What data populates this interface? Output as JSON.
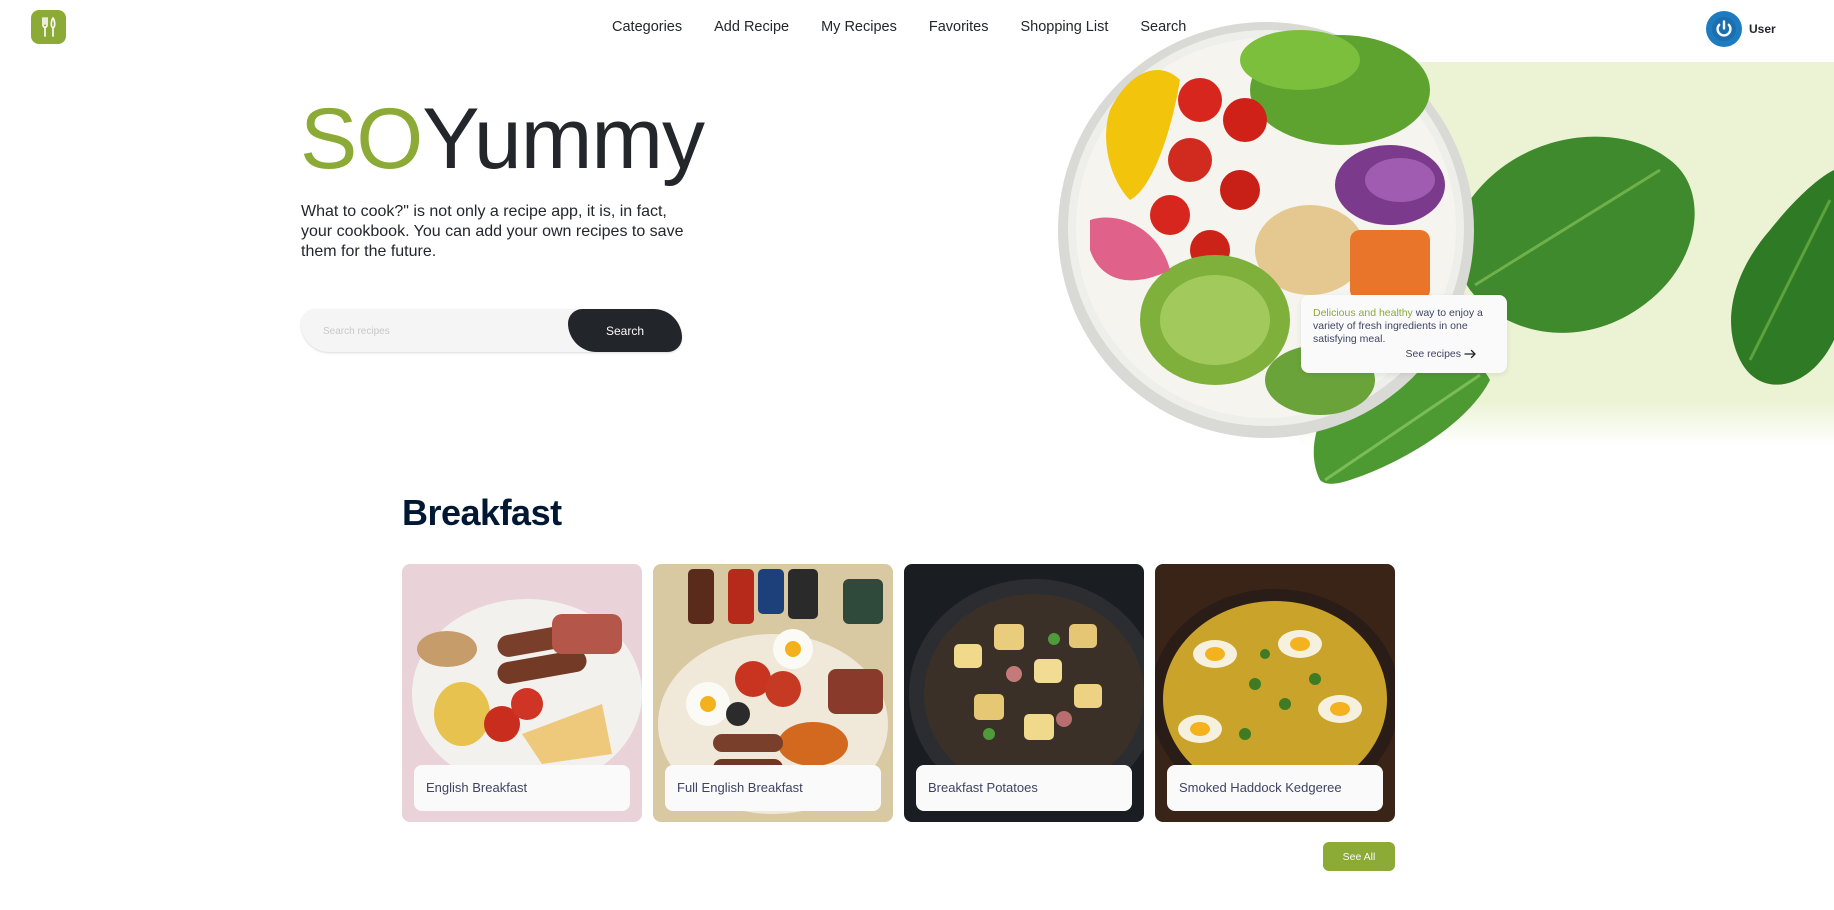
{
  "header": {
    "logo_icon": "fork-knife-icon",
    "nav": [
      "Categories",
      "Add Recipe",
      "My Recipes",
      "Favorites",
      "Shopping List",
      "Search"
    ],
    "user_name": "User",
    "avatar_icon": "power-icon"
  },
  "hero": {
    "title_accent": "SO",
    "title_main": "Yummy",
    "subtitle": "What to cook?\" is not only a recipe app, it is, in fact, your cookbook. You can add your own recipes to save them for the future.",
    "search_placeholder": "Search recipes",
    "search_button": "Search",
    "promo_accent": "Delicious and healthy",
    "promo_text": " way to enjoy a variety of fresh ingredients in one satisfying meal.",
    "promo_link": "See recipes",
    "promo_link_icon": "arrow-right-icon"
  },
  "section": {
    "title": "Breakfast",
    "recipes": [
      {
        "name": "English Breakfast"
      },
      {
        "name": "Full English Breakfast"
      },
      {
        "name": "Breakfast Potatoes"
      },
      {
        "name": "Smoked Haddock Kedgeree"
      }
    ],
    "see_all": "See All"
  },
  "colors": {
    "accent": "#8baa36",
    "dark": "#22252a",
    "heading": "#001833",
    "hero_bg": "#ebf3d4"
  }
}
